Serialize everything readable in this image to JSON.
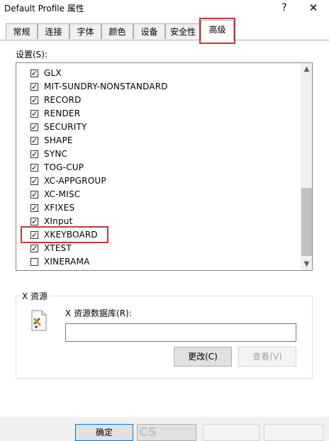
{
  "window": {
    "title": "Default Profile 属性",
    "help_glyph": "?",
    "close_glyph": "✕"
  },
  "tabs": [
    {
      "label": "常规",
      "active": false
    },
    {
      "label": "连接",
      "active": false
    },
    {
      "label": "字体",
      "active": false
    },
    {
      "label": "颜色",
      "active": false
    },
    {
      "label": "设备",
      "active": false
    },
    {
      "label": "安全性",
      "active": false
    },
    {
      "label": "高级",
      "active": true
    }
  ],
  "settings": {
    "label": "设置(S):",
    "items": [
      {
        "label": "GLX",
        "checked": true
      },
      {
        "label": "MIT-SUNDRY-NONSTANDARD",
        "checked": true
      },
      {
        "label": "RECORD",
        "checked": true
      },
      {
        "label": "RENDER",
        "checked": true
      },
      {
        "label": "SECURITY",
        "checked": true
      },
      {
        "label": "SHAPE",
        "checked": true
      },
      {
        "label": "SYNC",
        "checked": true
      },
      {
        "label": "TOG-CUP",
        "checked": true
      },
      {
        "label": "XC-APPGROUP",
        "checked": true
      },
      {
        "label": "XC-MISC",
        "checked": true
      },
      {
        "label": "XFIXES",
        "checked": true
      },
      {
        "label": "XInput",
        "checked": true
      },
      {
        "label": "XKEYBOARD",
        "checked": true
      },
      {
        "label": "XTEST",
        "checked": true
      },
      {
        "label": "XINERAMA",
        "checked": false
      }
    ]
  },
  "x_resources": {
    "group_title": "X 资源",
    "db_label": "X 资源数据库(R):",
    "db_value": "",
    "change_label": "更改(C)",
    "view_label": "查看(V)"
  },
  "footer": {
    "ok_label": "确定",
    "cancel_label": "CS",
    "apply_label": "",
    "help_label": ""
  },
  "colors": {
    "highlight_border": "#c0393b",
    "accent": "#0078d7"
  }
}
